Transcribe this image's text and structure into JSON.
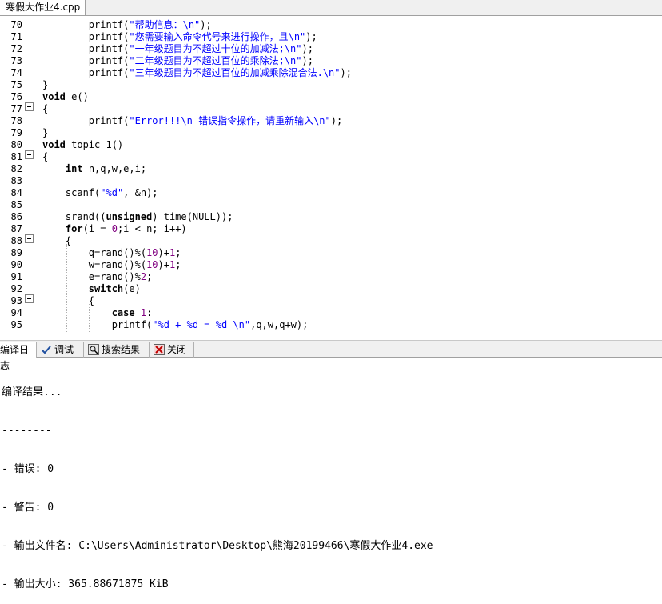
{
  "file_tab": {
    "label": "寒假大作业4.cpp"
  },
  "code_lines": [
    {
      "num": "70",
      "indent": "        ",
      "parts": [
        {
          "t": "printf(",
          "c": ""
        },
        {
          "t": "\"帮助信息：\\n\"",
          "c": "str"
        },
        {
          "t": ");",
          "c": ""
        }
      ]
    },
    {
      "num": "71",
      "indent": "        ",
      "parts": [
        {
          "t": "printf(",
          "c": ""
        },
        {
          "t": "\"您需要输入命令代号来进行操作，且\\n\"",
          "c": "str"
        },
        {
          "t": ");",
          "c": ""
        }
      ]
    },
    {
      "num": "72",
      "indent": "        ",
      "parts": [
        {
          "t": "printf(",
          "c": ""
        },
        {
          "t": "\"一年级题目为不超过十位的加减法;\\n\"",
          "c": "str"
        },
        {
          "t": ");",
          "c": ""
        }
      ]
    },
    {
      "num": "73",
      "indent": "        ",
      "parts": [
        {
          "t": "printf(",
          "c": ""
        },
        {
          "t": "\"二年级题目为不超过百位的乘除法;\\n\"",
          "c": "str"
        },
        {
          "t": ");",
          "c": ""
        }
      ]
    },
    {
      "num": "74",
      "indent": "        ",
      "parts": [
        {
          "t": "printf(",
          "c": ""
        },
        {
          "t": "\"三年级题目为不超过百位的加减乘除混合法.\\n\"",
          "c": "str"
        },
        {
          "t": ");",
          "c": ""
        }
      ]
    },
    {
      "num": "75",
      "indent": "",
      "parts": [
        {
          "t": "}",
          "c": ""
        }
      ]
    },
    {
      "num": "76",
      "indent": "",
      "parts": [
        {
          "t": "void",
          "c": "kw"
        },
        {
          "t": " e()",
          "c": ""
        }
      ]
    },
    {
      "num": "77",
      "indent": "",
      "parts": [
        {
          "t": "{",
          "c": ""
        }
      ]
    },
    {
      "num": "78",
      "indent": "        ",
      "parts": [
        {
          "t": "printf(",
          "c": ""
        },
        {
          "t": "\"Error!!!\\n 错误指令操作，请重新输入\\n\"",
          "c": "str"
        },
        {
          "t": ");",
          "c": ""
        }
      ]
    },
    {
      "num": "79",
      "indent": "",
      "parts": [
        {
          "t": "}",
          "c": ""
        }
      ]
    },
    {
      "num": "80",
      "indent": "",
      "parts": [
        {
          "t": "void",
          "c": "kw"
        },
        {
          "t": " topic_1()",
          "c": ""
        }
      ]
    },
    {
      "num": "81",
      "indent": "",
      "parts": [
        {
          "t": "{",
          "c": ""
        }
      ]
    },
    {
      "num": "82",
      "indent": "    ",
      "parts": [
        {
          "t": "int",
          "c": "kw"
        },
        {
          "t": " n,q,w,e,i;",
          "c": ""
        }
      ]
    },
    {
      "num": "83",
      "indent": "",
      "parts": []
    },
    {
      "num": "84",
      "indent": "    ",
      "parts": [
        {
          "t": "scanf(",
          "c": ""
        },
        {
          "t": "\"%d\"",
          "c": "str"
        },
        {
          "t": ", &n);",
          "c": ""
        }
      ]
    },
    {
      "num": "85",
      "indent": "",
      "parts": []
    },
    {
      "num": "86",
      "indent": "    ",
      "parts": [
        {
          "t": "srand((",
          "c": ""
        },
        {
          "t": "unsigned",
          "c": "kw"
        },
        {
          "t": ") time(NULL));",
          "c": ""
        }
      ]
    },
    {
      "num": "87",
      "indent": "    ",
      "parts": [
        {
          "t": "for",
          "c": "kw"
        },
        {
          "t": "(i = ",
          "c": ""
        },
        {
          "t": "0",
          "c": "num"
        },
        {
          "t": ";i < n; i++)",
          "c": ""
        }
      ]
    },
    {
      "num": "88",
      "indent": "    ",
      "parts": [
        {
          "t": "{",
          "c": ""
        }
      ]
    },
    {
      "num": "89",
      "indent": "        ",
      "parts": [
        {
          "t": "q=rand()%(",
          "c": ""
        },
        {
          "t": "10",
          "c": "num"
        },
        {
          "t": ")+",
          "c": ""
        },
        {
          "t": "1",
          "c": "num"
        },
        {
          "t": ";",
          "c": ""
        }
      ]
    },
    {
      "num": "90",
      "indent": "        ",
      "parts": [
        {
          "t": "w=rand()%(",
          "c": ""
        },
        {
          "t": "10",
          "c": "num"
        },
        {
          "t": ")+",
          "c": ""
        },
        {
          "t": "1",
          "c": "num"
        },
        {
          "t": ";",
          "c": ""
        }
      ]
    },
    {
      "num": "91",
      "indent": "        ",
      "parts": [
        {
          "t": "e=rand()%",
          "c": ""
        },
        {
          "t": "2",
          "c": "num"
        },
        {
          "t": ";",
          "c": ""
        }
      ]
    },
    {
      "num": "92",
      "indent": "        ",
      "parts": [
        {
          "t": "switch",
          "c": "kw"
        },
        {
          "t": "(e)",
          "c": ""
        }
      ]
    },
    {
      "num": "93",
      "indent": "        ",
      "parts": [
        {
          "t": "{",
          "c": ""
        }
      ]
    },
    {
      "num": "94",
      "indent": "            ",
      "parts": [
        {
          "t": "case",
          "c": "kw"
        },
        {
          "t": " ",
          "c": ""
        },
        {
          "t": "1",
          "c": "num"
        },
        {
          "t": ":",
          "c": ""
        }
      ]
    },
    {
      "num": "95",
      "indent": "            ",
      "parts": [
        {
          "t": "printf(",
          "c": ""
        },
        {
          "t": "\"%d + %d = %d \\n\"",
          "c": "str"
        },
        {
          "t": ",q,w,q+w);",
          "c": ""
        }
      ]
    }
  ],
  "panel_tabs": [
    {
      "label": "编译日志",
      "icon": "compile-log-icon"
    },
    {
      "label": "调试",
      "icon": "debug-check-icon"
    },
    {
      "label": "搜索结果",
      "icon": "search-results-icon"
    },
    {
      "label": "关闭",
      "icon": "close-panel-icon"
    }
  ],
  "compile_log": [
    "编译结果...",
    "--------",
    "- 错误: 0",
    "- 警告: 0",
    "- 输出文件名: C:\\Users\\Administrator\\Desktop\\熊海20199466\\寒假大作业4.exe",
    "- 输出大小: 365.88671875 KiB"
  ],
  "colors": {
    "string": "#0000ff",
    "number": "#800080",
    "keyword": "#000000",
    "tab_bg": "#f0f0f0"
  }
}
